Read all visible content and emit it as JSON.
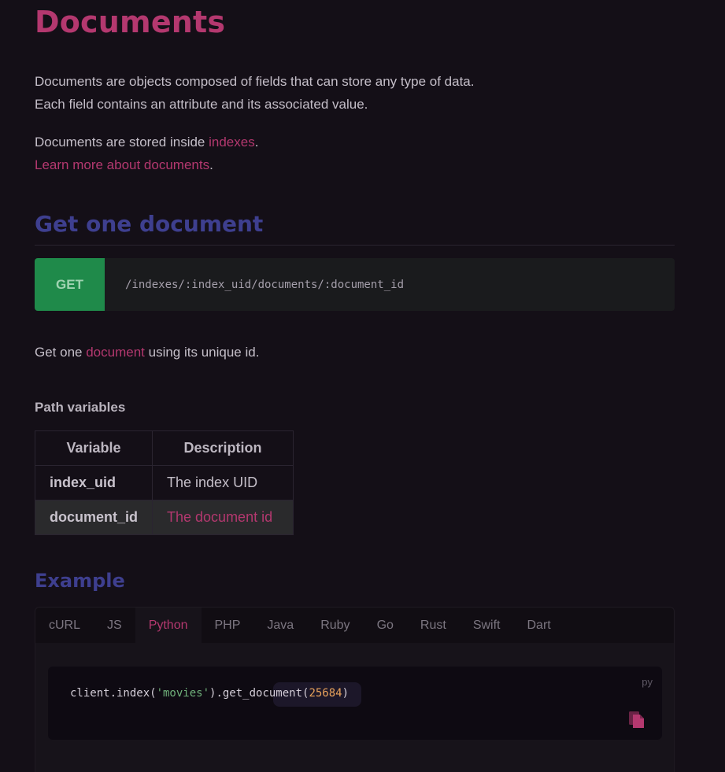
{
  "page_title": "Documents",
  "intro": {
    "line1": "Documents are objects composed of fields that can store any type of data.",
    "line2": "Each field contains an attribute and its associated value.",
    "stored_prefix": "Documents are stored inside ",
    "stored_link": "indexes",
    "stored_suffix": ".",
    "learn_more_link": "Learn more about documents",
    "learn_more_suffix": "."
  },
  "get_one": {
    "heading": "Get one document",
    "method": "GET",
    "path": "/indexes/:index_uid/documents/:document_id",
    "desc_prefix": "Get one ",
    "desc_link": "document",
    "desc_suffix": " using its unique id."
  },
  "path_variables": {
    "heading": "Path variables",
    "headers": [
      "Variable",
      "Description"
    ],
    "rows": [
      {
        "variable": "index_uid",
        "description": "The index UID"
      },
      {
        "variable": "document_id",
        "description": "The document id"
      }
    ]
  },
  "example": {
    "heading": "Example",
    "tabs": [
      "cURL",
      "JS",
      "Python",
      "PHP",
      "Java",
      "Ruby",
      "Go",
      "Rust",
      "Swift",
      "Dart"
    ],
    "active_tab": "Python",
    "lang_label": "py",
    "code": {
      "prefix": "client.index(",
      "string": "'movies'",
      "middle": ").get_document(",
      "number": "25684",
      "suffix": ")"
    },
    "copy_icon": "copy-icon"
  },
  "colors": {
    "accent": "#b4386f",
    "heading2": "#3e3f8f",
    "method_bg": "#1f8a4a",
    "background": "#140f17"
  }
}
